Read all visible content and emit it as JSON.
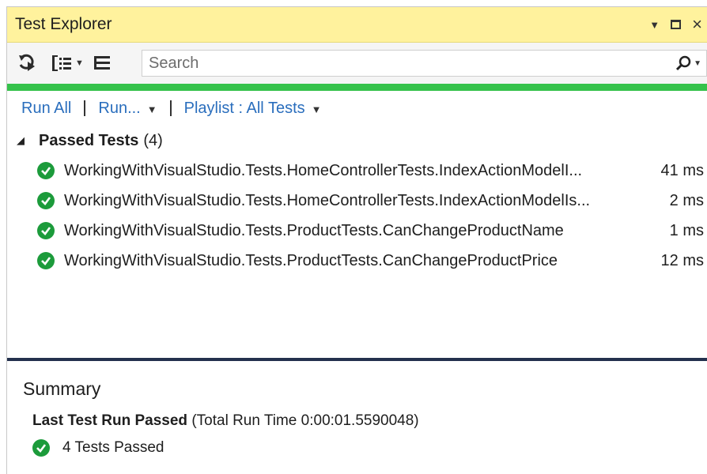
{
  "window": {
    "title": "Test Explorer"
  },
  "toolbar": {
    "search_placeholder": "Search"
  },
  "commands": {
    "run_all": "Run All",
    "run": "Run...",
    "playlist": "Playlist : All Tests"
  },
  "tests": {
    "group_title": "Passed Tests",
    "group_count": "(4)",
    "items": [
      {
        "name": "WorkingWithVisualStudio.Tests.HomeControllerTests.IndexActionModelI...",
        "time": "41 ms"
      },
      {
        "name": "WorkingWithVisualStudio.Tests.HomeControllerTests.IndexActionModelIs...",
        "time": "2 ms"
      },
      {
        "name": "WorkingWithVisualStudio.Tests.ProductTests.CanChangeProductName",
        "time": "1 ms"
      },
      {
        "name": "WorkingWithVisualStudio.Tests.ProductTests.CanChangeProductPrice",
        "time": "12 ms"
      }
    ]
  },
  "summary": {
    "title": "Summary",
    "last_run_label": "Last Test Run Passed",
    "total_run_time": "(Total Run Time 0:00:01.5590048)",
    "result_text": "4 Tests Passed"
  },
  "colors": {
    "title_bar": "#fff29d",
    "progress_passed": "#35c24b",
    "pass_icon": "#1c9b3b",
    "link": "#2a6ebd",
    "divider": "#23304d"
  },
  "icons": {
    "toolbar": [
      "run-refresh-icon",
      "group-by-icon",
      "list-view-icon"
    ],
    "search": "search-icon",
    "test_status": "passed-check-icon"
  }
}
